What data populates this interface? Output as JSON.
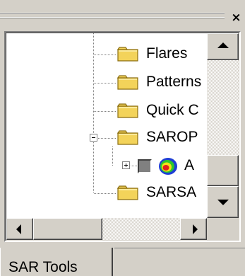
{
  "panel": {
    "close_glyph": "×"
  },
  "tree": {
    "items": [
      {
        "label": "Flares",
        "icon": "folder-icon",
        "expander": "none"
      },
      {
        "label": "Patterns",
        "icon": "folder-icon",
        "expander": "none"
      },
      {
        "label": "Quick C",
        "icon": "folder-icon",
        "expander": "none"
      },
      {
        "label": "SAROP",
        "icon": "folder-icon",
        "expander": "minus"
      },
      {
        "label": "A",
        "icon": "heatmap-layer-icon",
        "expander": "plus",
        "checkbox": true
      },
      {
        "label": "SARSA",
        "icon": "folder-icon",
        "expander": "none"
      }
    ]
  },
  "tabs": [
    {
      "label": "SAR Tools",
      "active": true
    }
  ],
  "colors": {
    "face": "#d4d0c8",
    "folder": "#f3d35a",
    "folder_dark": "#8a6d10"
  }
}
